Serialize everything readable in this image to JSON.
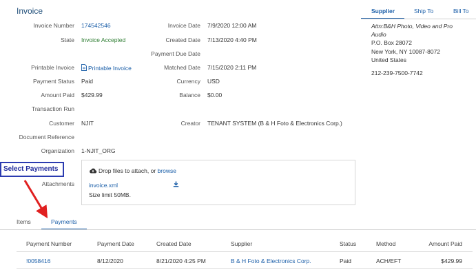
{
  "header": {
    "title": "Invoice"
  },
  "side_tabs": [
    {
      "label": "Supplier",
      "active": true
    },
    {
      "label": "Ship To",
      "active": false
    },
    {
      "label": "Bill To",
      "active": false
    }
  ],
  "supplier_address": {
    "attn": "Attn:B&H Photo, Video and Pro",
    "attn2": "Audio",
    "line1": "P.O. Box 28072",
    "line2": "New York,  NY  10087-8072",
    "line3": "United States",
    "phone": "212-239-7500-7742"
  },
  "left_fields": {
    "invoice_number": {
      "label": "Invoice Number",
      "value": "174542546"
    },
    "state": {
      "label": "State",
      "value": "Invoice Accepted"
    },
    "printable_invoice": {
      "label": "Printable Invoice",
      "value": "Printable Invoice"
    },
    "payment_status": {
      "label": "Payment Status",
      "value": "Paid"
    },
    "amount_paid": {
      "label": "Amount Paid",
      "value": "$429.99"
    },
    "transaction_run": {
      "label": "Transaction Run",
      "value": ""
    },
    "customer": {
      "label": "Customer",
      "value": "NJIT"
    },
    "document_reference": {
      "label": "Document Reference",
      "value": ""
    },
    "organization": {
      "label": "Organization",
      "value": "1-NJIT_ORG"
    },
    "attachments": {
      "label": "Attachments"
    }
  },
  "right_fields": {
    "invoice_date": {
      "label": "Invoice Date",
      "value": "7/9/2020 12:00 AM"
    },
    "created_date": {
      "label": "Created Date",
      "value": "7/13/2020 4:40 PM"
    },
    "payment_due_date": {
      "label": "Payment Due Date",
      "value": ""
    },
    "matched_date": {
      "label": "Matched Date",
      "value": "7/15/2020 2:11 PM"
    },
    "currency": {
      "label": "Currency",
      "value": "USD"
    },
    "balance": {
      "label": "Balance",
      "value": "$0.00"
    },
    "creator": {
      "label": "Creator",
      "value": "TENANT SYSTEM (B & H Foto & Electronics Corp.)"
    }
  },
  "attachments": {
    "drop_text": "Drop files to attach, or",
    "browse_label": "browse",
    "file_name": "invoice.xml",
    "size_limit": "Size limit 50MB."
  },
  "callout": {
    "text": "Select Payments",
    "color": "#e02020"
  },
  "subtabs": [
    {
      "label": "Items",
      "active": false
    },
    {
      "label": "Payments",
      "active": true
    }
  ],
  "payments_table": {
    "columns": [
      "Payment Number",
      "Payment Date",
      "Created Date",
      "Supplier",
      "Status",
      "Method",
      "Amount Paid"
    ],
    "rows": [
      [
        "!0058416",
        "8/12/2020",
        "8/21/2020 4:25 PM",
        "B & H Foto & Electronics Corp.",
        "Paid",
        "ACH/EFT",
        "$429.99"
      ]
    ]
  },
  "colors": {
    "accent": "#1a5ea8",
    "status_green": "#2e7d32",
    "callout_border": "#2b3bb0",
    "arrow": "#e02020"
  }
}
